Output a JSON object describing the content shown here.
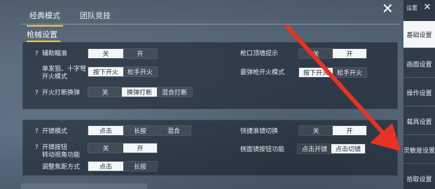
{
  "tabs": [
    {
      "label": "经典模式",
      "active": true
    },
    {
      "label": "团队竞技",
      "active": false
    }
  ],
  "section_title": "枪械设置",
  "panel1": {
    "aim_assist": {
      "label": "辅助瞄准",
      "off": "关",
      "on": "开",
      "selected": "off"
    },
    "muzzle_hint": {
      "label": "枪口顶墙提示",
      "off": "关",
      "on": "开",
      "selected": "on"
    },
    "single_fire": {
      "label_line1": "单发狙、十字弩",
      "label_line2": "开火模式",
      "opt1": "按下开火",
      "opt2": "松手开火",
      "selected": "opt1"
    },
    "shotgun_fire": {
      "label": "霰弹枪开火模式",
      "opt1": "按下开火",
      "opt2": "松手开火",
      "selected": "opt1"
    },
    "fire_reload": {
      "label": "开火打断换弹",
      "opt1": "关",
      "opt2": "换弹打断",
      "opt3": "混合打断",
      "selected": "opt2"
    }
  },
  "panel2": {
    "scope_mode": {
      "label": "开镜模式",
      "opt1": "点击",
      "opt2": "长按",
      "opt3": "混合",
      "selected": "opt1"
    },
    "quick_scope": {
      "label": "快捷准镜切换",
      "off": "关",
      "on": "开",
      "selected": "on"
    },
    "scope_button": {
      "label_line1": "开镜按钮",
      "label_line2": "转动视角功能",
      "off": "关",
      "on": "开",
      "selected": "on"
    },
    "side_scope": {
      "label": "侧面镜按钮功能",
      "opt1": "点击开镜",
      "opt2": "点击切镜",
      "selected": "opt2"
    },
    "focus_mode": {
      "label": "调整焦距方式",
      "opt1": "点击",
      "opt2": "长按",
      "selected": "opt1"
    }
  },
  "question_mark": "?",
  "sidebar": {
    "header": "设置",
    "close": "✕",
    "items": [
      {
        "label": "基础设置",
        "active": true
      },
      {
        "label": "画面设置",
        "active": false
      },
      {
        "label": "操作设置",
        "active": false
      },
      {
        "label": "载具设置",
        "active": false
      },
      {
        "label": "灵敏度设置",
        "active": false
      },
      {
        "label": "拾取设置",
        "active": false
      }
    ]
  },
  "close_icon": "✕",
  "colors": {
    "accent": "#f2c94c",
    "arrow": "#e63323",
    "selected_bg": "#f4f6f8"
  }
}
